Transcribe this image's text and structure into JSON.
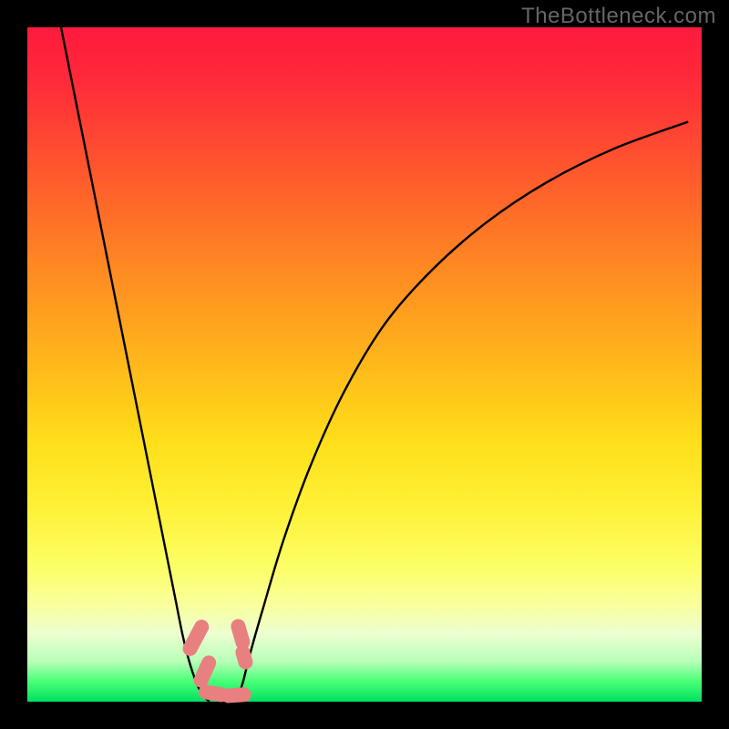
{
  "watermark": "TheBottleneck.com",
  "chart_data": {
    "type": "line",
    "title": "",
    "xlabel": "",
    "ylabel": "",
    "xlim": [
      0,
      100
    ],
    "ylim": [
      0,
      100
    ],
    "series": [
      {
        "name": "left-curve",
        "x": [
          5,
          7,
          9,
          11,
          13,
          15,
          17,
          19,
          21,
          22,
          23,
          24,
          25,
          26,
          27
        ],
        "y": [
          100,
          90,
          80,
          70,
          60,
          50,
          40,
          30,
          20,
          15,
          10,
          6,
          3,
          1,
          0
        ]
      },
      {
        "name": "right-curve",
        "x": [
          31,
          32,
          33,
          35,
          38,
          42,
          47,
          53,
          60,
          68,
          77,
          87,
          98
        ],
        "y": [
          0,
          3,
          7,
          14,
          24,
          35,
          46,
          56,
          64,
          71,
          77,
          82,
          86
        ]
      }
    ],
    "floor_band": {
      "y_start": 0,
      "y_end": 2
    },
    "markers": [
      {
        "name": "left-top",
        "cx": 25.0,
        "cy": 9.5,
        "w": 2.2,
        "h": 5.8,
        "rot": 28
      },
      {
        "name": "left-low",
        "cx": 26.4,
        "cy": 4.5,
        "w": 2.2,
        "h": 5.0,
        "rot": 24
      },
      {
        "name": "right-top",
        "cx": 31.6,
        "cy": 10.0,
        "w": 2.2,
        "h": 4.6,
        "rot": -16
      },
      {
        "name": "right-low",
        "cx": 32.2,
        "cy": 6.6,
        "w": 2.2,
        "h": 3.6,
        "rot": -16
      },
      {
        "name": "bottom-left",
        "cx": 27.6,
        "cy": 1.2,
        "w": 4.4,
        "h": 2.2,
        "rot": 10
      },
      {
        "name": "bottom-right",
        "cx": 31.0,
        "cy": 1.0,
        "w": 4.4,
        "h": 2.2,
        "rot": -4
      }
    ]
  }
}
